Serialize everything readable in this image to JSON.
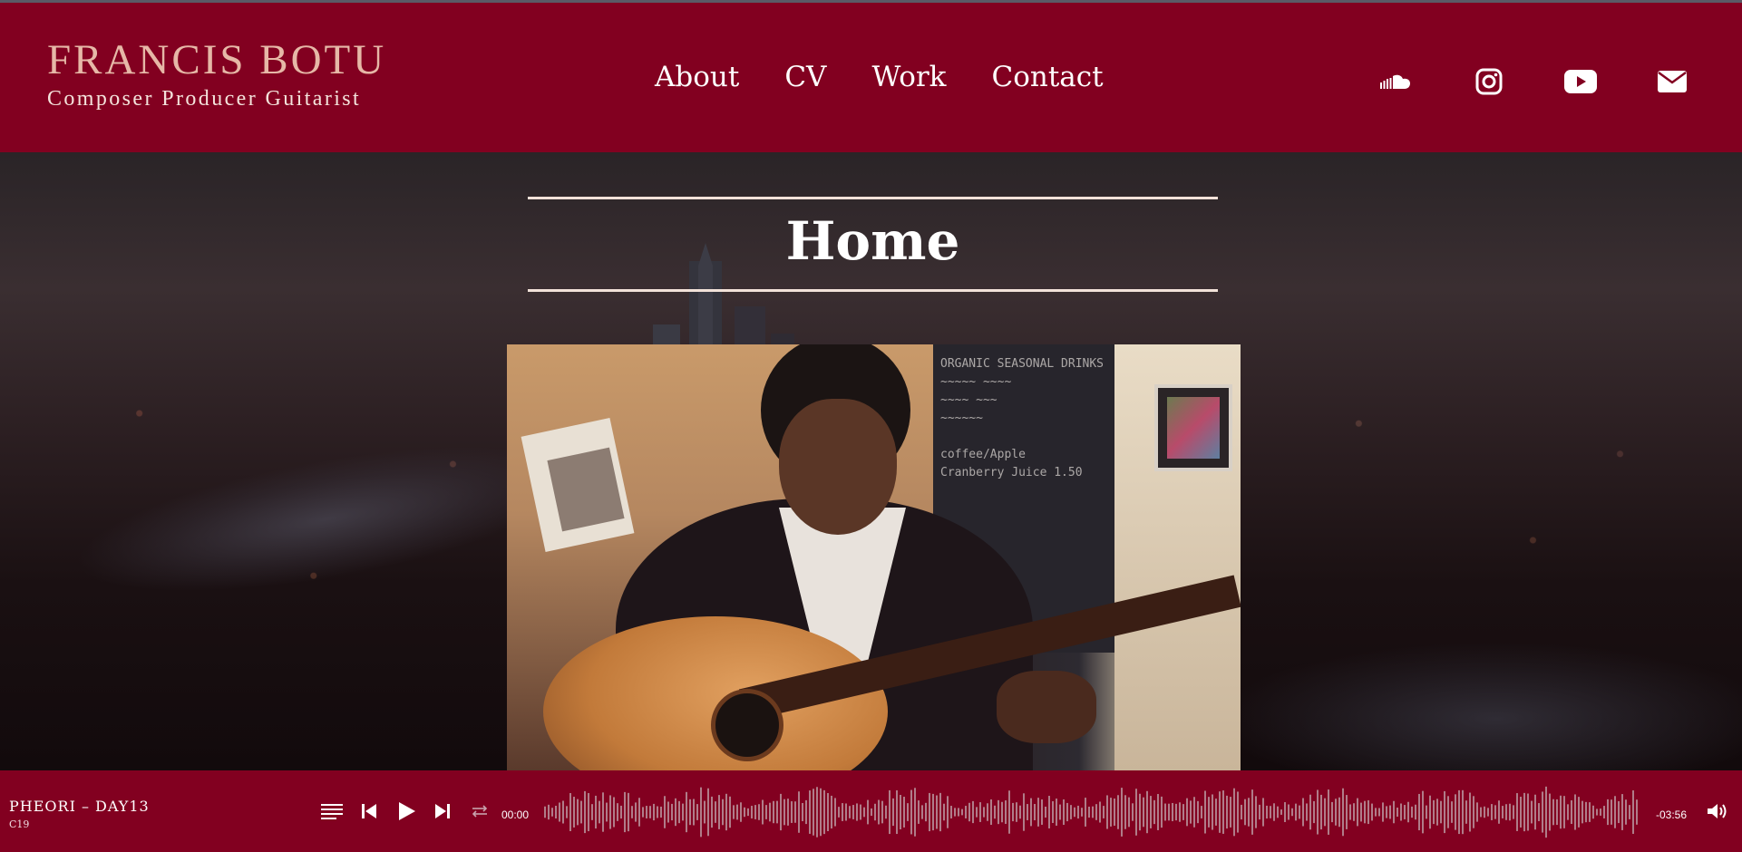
{
  "brand": {
    "name": "FRANCIS BOTU",
    "tagline": "Composer Producer Guitarist"
  },
  "nav": {
    "items": [
      {
        "label": "About"
      },
      {
        "label": "CV"
      },
      {
        "label": "Work"
      },
      {
        "label": "Contact"
      }
    ]
  },
  "social": {
    "icons": [
      "soundcloud-icon",
      "instagram-icon",
      "youtube-icon",
      "email-icon"
    ]
  },
  "hero": {
    "title": "Home"
  },
  "photo": {
    "board_text": "ORGANIC SEASONAL DRINKS\n~~~~~ ~~~~\n~~~~ ~~~\n~~~~~~\n\ncoffee/Apple\nCranberry Juice 1.50"
  },
  "player": {
    "track_title": "PHEORI – DAY13",
    "track_artist": "C19",
    "time_elapsed": "00:00",
    "time_remaining": "-03:56",
    "controls": [
      "playlist-icon",
      "previous-icon",
      "play-icon",
      "next-icon",
      "repeat-icon",
      "volume-icon"
    ]
  },
  "colors": {
    "brand": "#820020",
    "brand_name": "#e6b8a7",
    "accent_rule": "#f2e2d9",
    "waveform": "#b8929c"
  }
}
